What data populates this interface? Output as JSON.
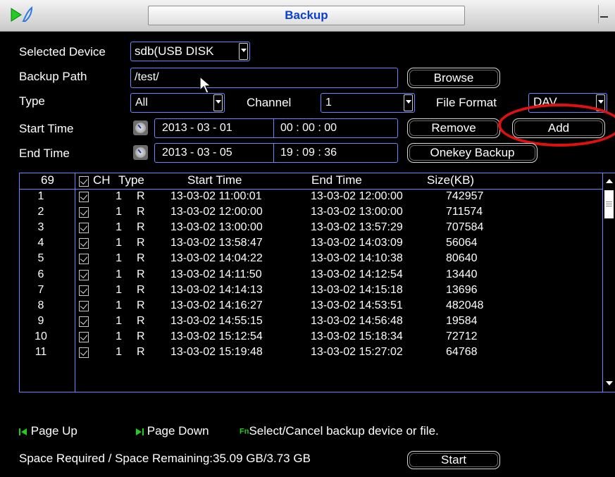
{
  "window": {
    "title": "Backup"
  },
  "form": {
    "selected_device_label": "Selected Device",
    "selected_device_value": "sdb(USB DISK",
    "backup_path_label": "Backup Path",
    "backup_path_value": "/test/",
    "browse_label": "Browse",
    "type_label": "Type",
    "type_value": "All",
    "channel_label": "Channel",
    "channel_value": "1",
    "file_format_label": "File Format",
    "file_format_value": "DAV",
    "start_time_label": "Start Time",
    "start_date": "2013  - 03 - 01",
    "start_clock": "00 : 00 : 00",
    "end_time_label": "End Time",
    "end_date": "2013  - 03 - 05",
    "end_clock": "19 : 09 : 36",
    "remove_label": "Remove",
    "add_label": "Add",
    "onekey_label": "Onekey Backup"
  },
  "table": {
    "count": "69",
    "headers": {
      "ch": "CH",
      "type": "Type",
      "start": "Start Time",
      "end": "End Time",
      "size": "Size(KB)"
    },
    "rows": [
      {
        "no": "1",
        "ch": "1",
        "type": "R",
        "start": "13-03-02 11:00:01",
        "end": "13-03-02 12:00:00",
        "size": "742957"
      },
      {
        "no": "2",
        "ch": "1",
        "type": "R",
        "start": "13-03-02 12:00:00",
        "end": "13-03-02 13:00:00",
        "size": "711574"
      },
      {
        "no": "3",
        "ch": "1",
        "type": "R",
        "start": "13-03-02 13:00:00",
        "end": "13-03-02 13:57:29",
        "size": "707584"
      },
      {
        "no": "4",
        "ch": "1",
        "type": "R",
        "start": "13-03-02 13:58:47",
        "end": "13-03-02 14:03:09",
        "size": "56064"
      },
      {
        "no": "5",
        "ch": "1",
        "type": "R",
        "start": "13-03-02 14:04:22",
        "end": "13-03-02 14:10:38",
        "size": "80640"
      },
      {
        "no": "6",
        "ch": "1",
        "type": "R",
        "start": "13-03-02 14:11:50",
        "end": "13-03-02 14:12:54",
        "size": "13440"
      },
      {
        "no": "7",
        "ch": "1",
        "type": "R",
        "start": "13-03-02 14:14:13",
        "end": "13-03-02 14:15:18",
        "size": "13696"
      },
      {
        "no": "8",
        "ch": "1",
        "type": "R",
        "start": "13-03-02 14:16:27",
        "end": "13-03-02 14:53:51",
        "size": "482048"
      },
      {
        "no": "9",
        "ch": "1",
        "type": "R",
        "start": "13-03-02 14:55:15",
        "end": "13-03-02 14:56:48",
        "size": "19584"
      },
      {
        "no": "10",
        "ch": "1",
        "type": "R",
        "start": "13-03-02 15:12:54",
        "end": "13-03-02 15:18:34",
        "size": "72712"
      },
      {
        "no": "11",
        "ch": "1",
        "type": "R",
        "start": "13-03-02 15:19:48",
        "end": "13-03-02 15:27:02",
        "size": "64768"
      }
    ]
  },
  "footer": {
    "page_up_label": "Page Up",
    "page_down_label": "Page Down",
    "fn_badge": "Fn",
    "fn_hint": "Select/Cancel backup device or file.",
    "space_text": "Space Required / Space Remaining:35.09 GB/3.73 GB",
    "start_label": "Start"
  },
  "colors": {
    "accent": "#6f85ff",
    "title_text": "#0a3fcf",
    "highlight": "#e01010",
    "nav_green": "#1fd01f"
  },
  "icons": [
    "play-icon",
    "minimize-icon",
    "cursor-icon",
    "clock-icon",
    "page-up-icon",
    "page-down-icon"
  ]
}
